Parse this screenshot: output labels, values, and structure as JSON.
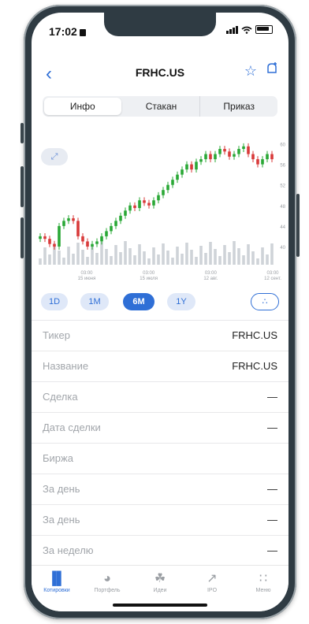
{
  "status": {
    "time": "17:02"
  },
  "nav": {
    "title": "FRHC.US"
  },
  "segments": [
    "Инфо",
    "Стакан",
    "Приказ"
  ],
  "range_buttons": [
    "1D",
    "1M",
    "6M",
    "1Y"
  ],
  "range_selected": "6M",
  "rows": [
    {
      "label": "Тикер",
      "value": "FRHC.US"
    },
    {
      "label": "Название",
      "value": "FRHC.US"
    },
    {
      "label": "Сделка",
      "value": "—"
    },
    {
      "label": "Дата сделки",
      "value": "—"
    },
    {
      "label": "Биржа",
      "value": ""
    },
    {
      "label": "За день",
      "value": "—"
    },
    {
      "label": "За день",
      "value": "—"
    },
    {
      "label": "За неделю",
      "value": "—"
    }
  ],
  "tabs": [
    {
      "label": "Котировки",
      "icon": "bar-chart-icon"
    },
    {
      "label": "Портфель",
      "icon": "pie-chart-icon"
    },
    {
      "label": "Идеи",
      "icon": "lightbulb-icon"
    },
    {
      "label": "IPO",
      "icon": "rocket-icon"
    },
    {
      "label": "Меню",
      "icon": "grid-icon"
    }
  ],
  "chart_data": {
    "type": "candlestick",
    "y_ticks": [
      "60",
      "56",
      "52",
      "48",
      "44",
      "40"
    ],
    "x_ticks": [
      {
        "time": "03:00",
        "date": "15 июня"
      },
      {
        "time": "03:00",
        "date": "15 июля"
      },
      {
        "time": "03:00",
        "date": "12 авг."
      },
      {
        "time": "03:00",
        "date": "12 сент."
      }
    ],
    "ylim": [
      38,
      61
    ],
    "close_approx": [
      42,
      41.5,
      40.5,
      40,
      44,
      45,
      45.5,
      45,
      42,
      41,
      40,
      40.5,
      41,
      42,
      43,
      44,
      45,
      46,
      47,
      48,
      47.5,
      49,
      48.5,
      48,
      49,
      50,
      51,
      52,
      53,
      54,
      55,
      56,
      55,
      56.5,
      57,
      58,
      57,
      58,
      59,
      58.5,
      57.5,
      58,
      59,
      59.5,
      58,
      57,
      56,
      57,
      58,
      57
    ]
  },
  "colors": {
    "accent": "#2f6fd6",
    "up": "#2aa836",
    "down": "#d93a3a"
  }
}
